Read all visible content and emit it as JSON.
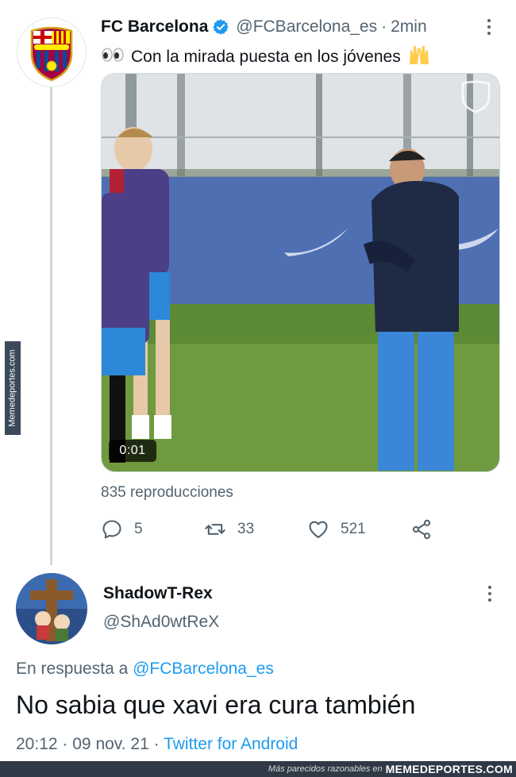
{
  "tweet": {
    "author_name": "FC Barcelona",
    "author_handle": "@FCBarcelona_es",
    "separator": "·",
    "time": "2min",
    "text_leading_emoji": "eyes",
    "text": "Con la mirada puesta en los jóvenes",
    "text_trailing_emoji": "raising-hands",
    "video_time": "0:01",
    "views": "835 reproducciones",
    "actions": {
      "replies": "5",
      "retweets": "33",
      "likes": "521"
    },
    "colors": {
      "verified": "#1d9bf0",
      "secondary_text": "#536471"
    }
  },
  "reply": {
    "author_name": "ShadowT-Rex",
    "author_handle": "@ShAd0wtReX",
    "in_reply_prefix": "En respuesta a",
    "in_reply_handle": "@FCBarcelona_es",
    "text": "No sabia que xavi era cura también",
    "time": "20:12",
    "separator": "·",
    "date": "09 nov. 21",
    "separator2": "·",
    "client": "Twitter for Android"
  },
  "watermark": {
    "side": "Memedeportes.com",
    "bottom_text": "Más parecidos razonables en",
    "bottom_brand": "MEMEDEPORTES.COM"
  }
}
